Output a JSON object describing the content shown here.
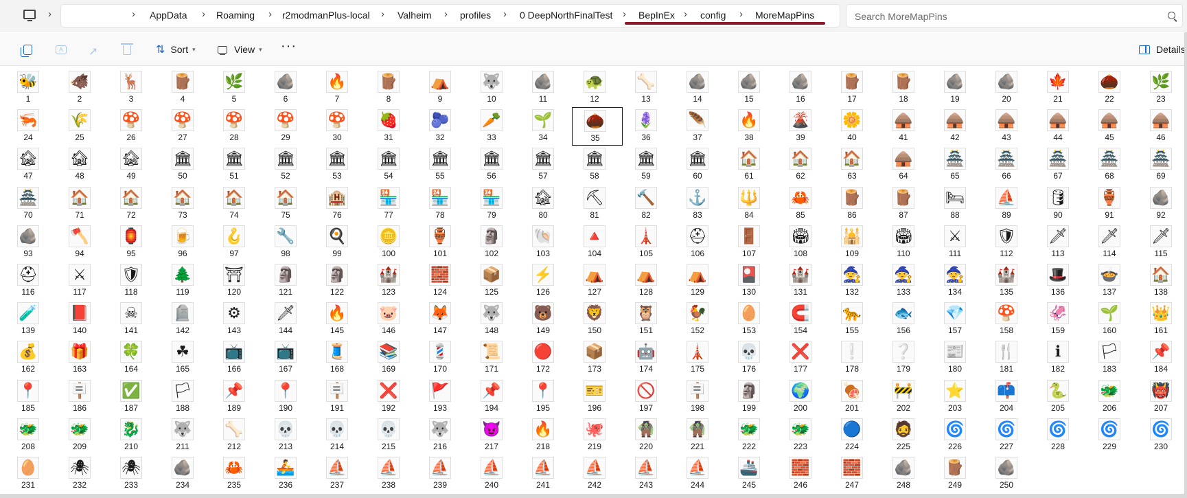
{
  "breadcrumb": [
    "AppData",
    "Roaming",
    "r2modmanPlus-local",
    "Valheim",
    "profiles",
    "0 DeepNorthFinalTest",
    "BepInEx",
    "config",
    "MoreMapPins"
  ],
  "search": {
    "placeholder": "Search MoreMapPins"
  },
  "toolbar": {
    "sort_label": "Sort",
    "view_label": "View",
    "more_label": "···",
    "details_label": "Details"
  },
  "grid": {
    "columns": 23,
    "count": 250,
    "selected": 35
  },
  "icons": [
    "🐝",
    "🐗",
    "🦌",
    "🪵",
    "🌿",
    "🪨",
    "🔥",
    "🪵",
    "⛺",
    "🐺",
    "🪨",
    "🐢",
    "🦴",
    "🪨",
    "🪨",
    "🪨",
    "🪵",
    "🪵",
    "🪨",
    "🪨",
    "🍁",
    "🌰",
    "🌿",
    "🦐",
    "🌾",
    "🍄",
    "🍄",
    "🍄",
    "🍄",
    "🍄",
    "🍓",
    "🫐",
    "🥕",
    "🌱",
    "🌰",
    "🪻",
    "🪶",
    "🔥",
    "🌋",
    "🌼",
    "🛖",
    "🛖",
    "🛖",
    "🛖",
    "🛖",
    "🛖",
    "🏚",
    "🏚",
    "🏚",
    "🏛",
    "🏛",
    "🏛",
    "🏛",
    "🏛",
    "🏛",
    "🏛",
    "🏛",
    "🏛",
    "🏛",
    "🏛",
    "🏠",
    "🏠",
    "🏠",
    "🛖",
    "🏯",
    "🏯",
    "🏯",
    "🏯",
    "🏯",
    "🏯",
    "🏠",
    "🏠",
    "🏠",
    "🏠",
    "🏠",
    "🏨",
    "🏪",
    "🏪",
    "🏪",
    "🏚",
    "⛏",
    "🔨",
    "⚓",
    "🔱",
    "🦀",
    "🪵",
    "🪵",
    "🛏",
    "⛵",
    "🛢",
    "🏺",
    "🪨",
    "🪨",
    "🪓",
    "🏮",
    "🍺",
    "🪝",
    "🔧",
    "🍳",
    "🪙",
    "🏺",
    "🗿",
    "🐚",
    "🔺",
    "🗼",
    "⛑",
    "🚪",
    "🏟",
    "🕌",
    "🏟",
    "⚔",
    "🛡",
    "🗡",
    "🗡",
    "🗡",
    "⛑",
    "⚔",
    "🛡",
    "🌲",
    "⛩",
    "🗿",
    "🗿",
    "🏰",
    "🧱",
    "📦",
    "⚡",
    "⛺",
    "⛺",
    "⛺",
    "🎴",
    "🏰",
    "🧙",
    "🧙",
    "🧙",
    "🏰",
    "🎩",
    "🍲",
    "🏠",
    "🧪",
    "📕",
    "☠",
    "🪦",
    "⚙",
    "🗡",
    "🔥",
    "🐷",
    "🦊",
    "🐺",
    "🐻",
    "🦁",
    "🦉",
    "🐓",
    "🥚",
    "🧲",
    "🐆",
    "🐟",
    "💎",
    "🍄",
    "🦑",
    "🌱",
    "👑",
    "💰",
    "🎁",
    "🍀",
    "☘",
    "📺",
    "📺",
    "🧵",
    "📚",
    "💈",
    "📜",
    "🔴",
    "📦",
    "🤖",
    "🗼",
    "💀",
    "❌",
    "❕",
    "❔",
    "📰",
    "🍴",
    "ℹ",
    "🏳",
    "📌",
    "📍",
    "🪧",
    "✅",
    "🏳",
    "📌",
    "📍",
    "🪧",
    "❌",
    "🚩",
    "📌",
    "📍",
    "🎫",
    "🚫",
    "🪧",
    "🗿",
    "🌍",
    "🍖",
    "🚧",
    "⭐",
    "📫",
    "🐍",
    "🐲",
    "👹",
    "🐲",
    "🐲",
    "🐉",
    "🐺",
    "🦴",
    "💀",
    "💀",
    "💀",
    "🐺",
    "😈",
    "🔥",
    "🐙",
    "🧌",
    "🧌",
    "🐲",
    "🐲",
    "🔵",
    "🧔",
    "🌀",
    "🌀",
    "🌀",
    "🌀",
    "🌀",
    "🥚",
    "🕷",
    "🕷",
    "🪨",
    "🦀",
    "🚣",
    "⛵",
    "⛵",
    "⛵",
    "⛵",
    "⛵",
    "⛵",
    "⛵",
    "⛵",
    "🚢",
    "🧱",
    "🧱",
    "🪨",
    "🪵",
    "🪨"
  ]
}
